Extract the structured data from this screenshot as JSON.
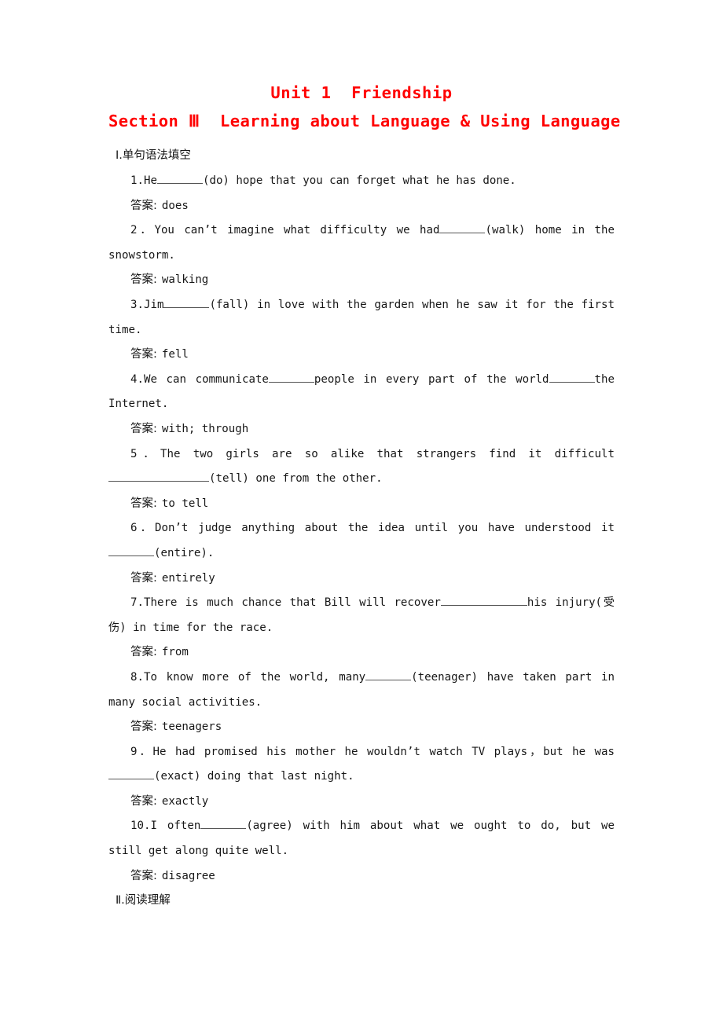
{
  "document": {
    "title_main": "Unit 1  Friendship",
    "title_sub": "Section Ⅲ  Learning about Language & Using Language",
    "sections": [
      {
        "id": "part1",
        "heading": "Ⅰ.单句语法填空"
      },
      {
        "id": "part2",
        "heading": "Ⅱ.阅读理解"
      }
    ],
    "answer_label": "答案:",
    "questions": [
      {
        "number": "1.",
        "text_before": "He",
        "blank": "short",
        "text_after": "(do) hope that you can forget what he has done.",
        "answer": "does"
      },
      {
        "number": "2．",
        "text_before": "You can’t imagine what difficulty we had",
        "blank": "short",
        "text_after": "(walk) home in the snowstorm.",
        "answer": "walking"
      },
      {
        "number": "3.",
        "text_before": "Jim",
        "blank": "short",
        "text_after": "(fall) in love with the garden when he saw it for the first time.",
        "answer": "fell"
      },
      {
        "number": "4.",
        "text_before": "We can communicate",
        "blank": "short",
        "text_mid": "people in every part of the world",
        "blank2": "short",
        "text_after": "the Internet.",
        "answer": "with; through"
      },
      {
        "number": "5．",
        "text_before": "The two girls are so alike that strangers find it difficult",
        "blank": "long",
        "text_after": "(tell) one from the other.",
        "answer": "to tell"
      },
      {
        "number": "6．",
        "text_before": "Don’t judge anything about the idea until you have understood it",
        "blank": "short",
        "text_after": "(entire).",
        "answer": "entirely"
      },
      {
        "number": "7.",
        "text_before": "There is much chance that Bill will recover",
        "blank": "long",
        "text_after": "his injury(受伤) in time for the race.",
        "answer": "from"
      },
      {
        "number": "8.",
        "text_before": "To know more of the world, many",
        "blank": "short",
        "text_after": "(teenager) have taken part in many social activities.",
        "answer": "teenagers"
      },
      {
        "number": "9．",
        "text_before": "He had promised his mother he wouldn’t watch TV plays，but he was",
        "blank": "short",
        "text_after": "(exact) doing that last night.",
        "answer": "exactly"
      },
      {
        "number": "10.",
        "text_before": "I often",
        "blank": "short",
        "text_after": "(agree) with him about what we ought to do, but we still get along quite well.",
        "answer": "disagree"
      }
    ]
  },
  "colors": {
    "title_red": "#ff0000",
    "body_text": "#171717",
    "blank_rule": "#555555"
  }
}
